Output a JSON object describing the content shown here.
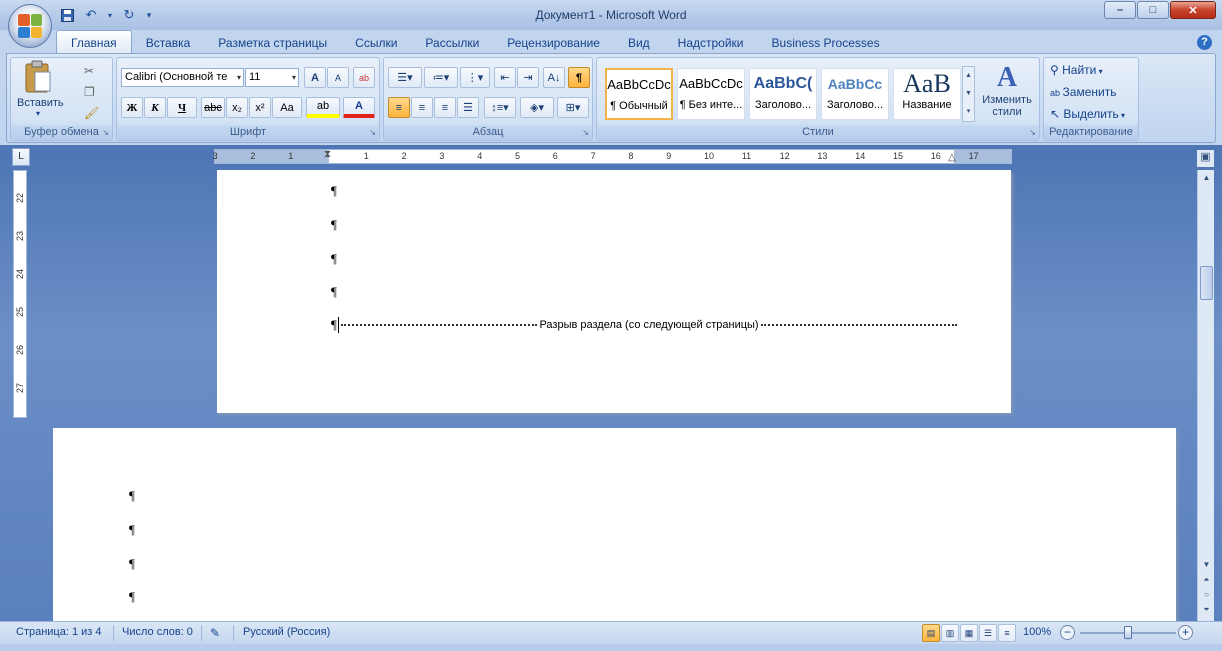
{
  "window": {
    "title": "Документ1 - Microsoft Word",
    "minimize": "–",
    "maximize": "□",
    "close": "✕"
  },
  "tabs": [
    "Главная",
    "Вставка",
    "Разметка страницы",
    "Ссылки",
    "Рассылки",
    "Рецензирование",
    "Вид",
    "Надстройки",
    "Business Processes"
  ],
  "help": "?",
  "ribbon": {
    "clipboard": {
      "label": "Буфер обмена",
      "paste": "Вставить"
    },
    "font": {
      "label": "Шрифт",
      "font_name": "Calibri (Основной те",
      "font_size": "11",
      "bold": "Ж",
      "italic": "К",
      "underline": "Ч",
      "strike": "abc",
      "subscript": "x₂",
      "superscript": "x²",
      "case": "Aa",
      "highlight": "ab",
      "color": "A",
      "grow": "A",
      "shrink": "A"
    },
    "paragraph": {
      "label": "Абзац",
      "pilcrow": "¶"
    },
    "styles": {
      "label": "Стили",
      "change": "Изменить стили",
      "items": [
        {
          "sample": "AaBbCcDc",
          "name": "¶ Обычный"
        },
        {
          "sample": "AaBbCcDc",
          "name": "¶ Без инте..."
        },
        {
          "sample": "AaBbC(",
          "name": "Заголово..."
        },
        {
          "sample": "AaBbCc",
          "name": "Заголово..."
        },
        {
          "sample": "AaB",
          "name": "Название"
        }
      ]
    },
    "editing": {
      "label": "Редактирование",
      "find": "Найти",
      "replace": "Заменить",
      "select": "Выделить"
    }
  },
  "ruler_corner": "L",
  "ruler_numbers": [
    "3",
    "2",
    "1",
    "1",
    "2",
    "3",
    "4",
    "5",
    "6",
    "7",
    "8",
    "9",
    "10",
    "11",
    "12",
    "13",
    "14",
    "15",
    "16",
    "17"
  ],
  "ruler_left_numbers": [
    "22",
    "23",
    "24",
    "25",
    "26",
    "27"
  ],
  "document": {
    "pilcrow": "¶",
    "section_break": "Разрыв раздела (со следующей страницы)"
  },
  "status": {
    "page": "Страница: 1 из 4",
    "words": "Число слов: 0",
    "language": "Русский (Россия)",
    "zoom": "100%",
    "zoom_level": 1.0
  },
  "colors": {
    "accent": "#15428b",
    "ribbon": "#dbe7f6",
    "doc_bg": "#5b7fb8"
  }
}
